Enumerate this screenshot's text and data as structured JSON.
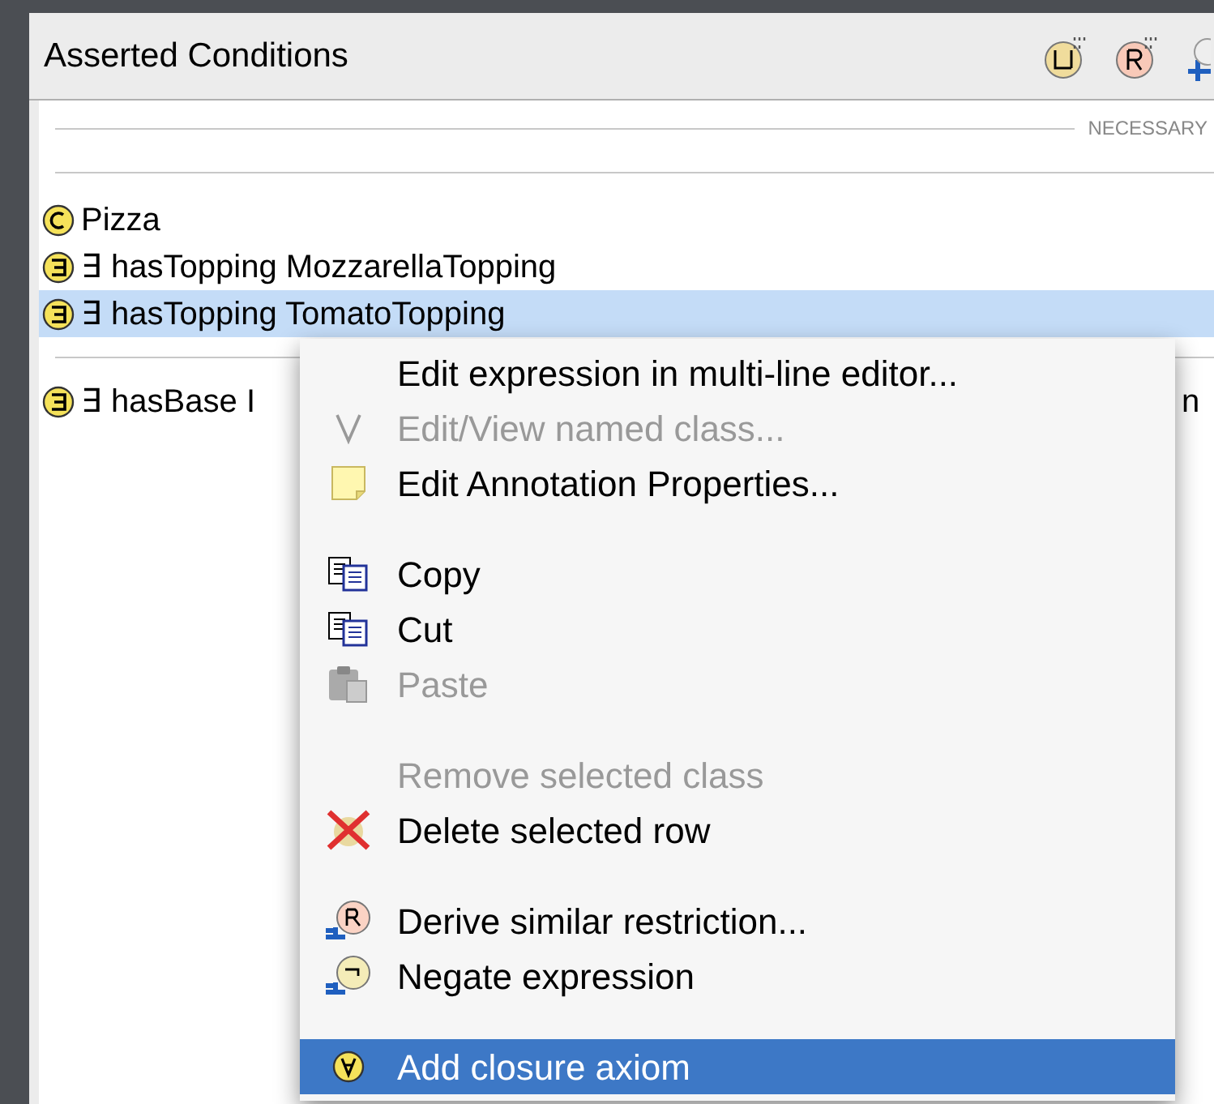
{
  "panel": {
    "title": "Asserted Conditions",
    "section_label": "NECESSARY"
  },
  "rows": [
    {
      "kind": "class",
      "text": "Pizza",
      "selected": false
    },
    {
      "kind": "some",
      "text": "∃ hasTopping MozzarellaTopping",
      "selected": false
    },
    {
      "kind": "some",
      "text": "∃ hasTopping TomatoTopping",
      "selected": true
    },
    {
      "kind": "divider"
    },
    {
      "kind": "some",
      "text": "∃ hasBase I",
      "tail": "n",
      "selected": false
    }
  ],
  "menu": {
    "groups": [
      [
        {
          "label": "Edit expression in multi-line editor...",
          "kind": "none",
          "disabled": false,
          "selected": false
        },
        {
          "label": "Edit/View named class...",
          "kind": "v",
          "disabled": true,
          "selected": false
        },
        {
          "label": "Edit Annotation Properties...",
          "kind": "note",
          "disabled": false,
          "selected": false
        }
      ],
      [
        {
          "label": "Copy",
          "kind": "copy",
          "disabled": false,
          "selected": false
        },
        {
          "label": "Cut",
          "kind": "copy",
          "disabled": false,
          "selected": false
        },
        {
          "label": "Paste",
          "kind": "paste",
          "disabled": true,
          "selected": false
        }
      ],
      [
        {
          "label": "Remove selected class",
          "kind": "none",
          "disabled": true,
          "selected": false
        },
        {
          "label": "Delete selected row",
          "kind": "delete",
          "disabled": false,
          "selected": false
        }
      ],
      [
        {
          "label": "Derive similar restriction...",
          "kind": "derive",
          "disabled": false,
          "selected": false
        },
        {
          "label": "Negate expression",
          "kind": "negate",
          "disabled": false,
          "selected": false
        }
      ],
      [
        {
          "label": "Add closure axiom",
          "kind": "closure",
          "disabled": false,
          "selected": true
        }
      ]
    ]
  }
}
